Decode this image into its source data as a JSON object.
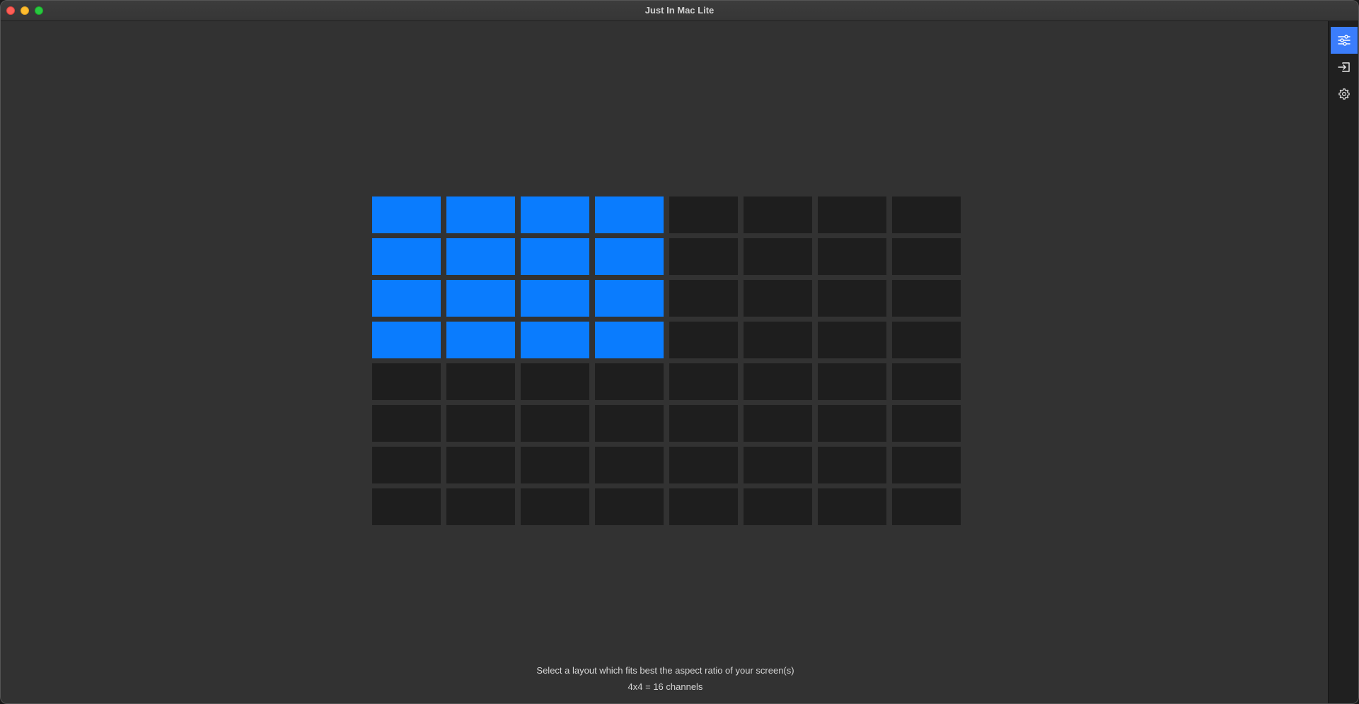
{
  "window": {
    "title": "Just In Mac Lite"
  },
  "sidebar": {
    "items": [
      {
        "icon": "sliders-icon",
        "active": true
      },
      {
        "icon": "input-icon",
        "active": false
      },
      {
        "icon": "gear-icon",
        "active": false
      }
    ]
  },
  "layout_grid": {
    "columns": 8,
    "rows": 8,
    "selected_columns": 4,
    "selected_rows": 4,
    "selected_color": "#0a7cfe",
    "unselected_color": "#1e1e1e"
  },
  "footer": {
    "instruction": "Select a layout which fits best the aspect ratio of your screen(s)",
    "selection_summary": "4x4 = 16 channels"
  },
  "colors": {
    "accent": "#3b7dfb",
    "background": "#323232",
    "sidebar": "#202020"
  }
}
